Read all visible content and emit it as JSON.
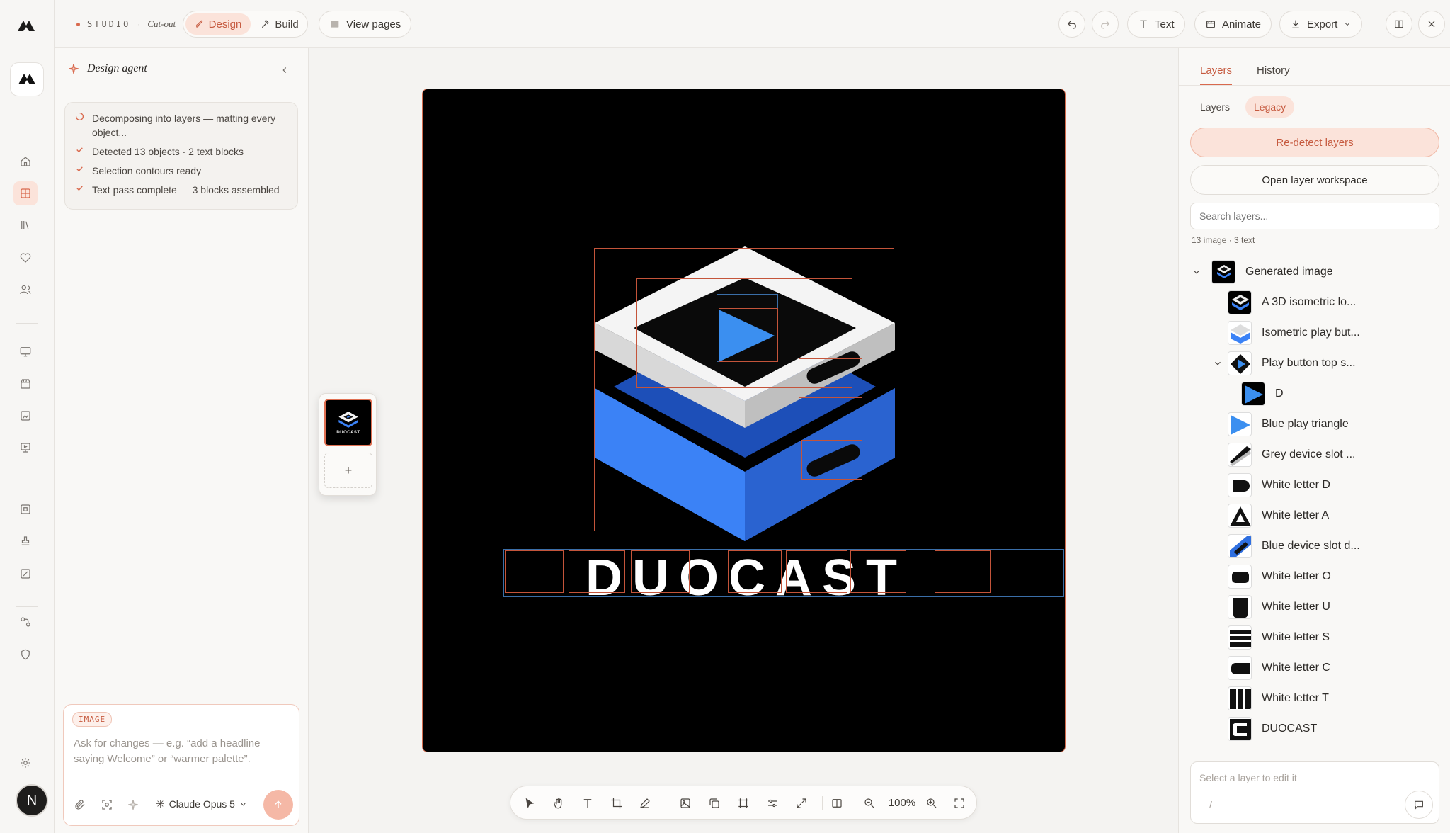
{
  "topbar": {
    "studio_label": "STUDIO",
    "separator": "·",
    "mode_label": "Cut-out",
    "design_tab": "Design",
    "build_tab": "Build",
    "view_pages": "View pages",
    "text_button": "Text",
    "animate_button": "Animate",
    "export_button": "Export"
  },
  "left_panel": {
    "title": "Design agent",
    "steps": [
      {
        "status": "running",
        "text": "Decomposing into layers — matting every object..."
      },
      {
        "status": "done",
        "text": "Detected 13 objects · 2 text blocks"
      },
      {
        "status": "done",
        "text": "Selection contours ready"
      },
      {
        "status": "done",
        "text": "Text pass complete — 3 blocks assembled"
      }
    ],
    "composer": {
      "tag": "IMAGE",
      "placeholder": "Ask for changes — e.g. “add a headline saying Welcome” or “warmer palette”.",
      "model": "Claude Opus 5"
    }
  },
  "canvas": {
    "logo_text": "DUOCAST",
    "thumb_label": "DUOCAST",
    "add_page": "+"
  },
  "toolbar": {
    "zoom": "100%"
  },
  "right_panel": {
    "tabs": [
      "Layers",
      "History"
    ],
    "subtabs": [
      "Layers",
      "Legacy"
    ],
    "redetect": "Re-detect layers",
    "open_workspace": "Open layer workspace",
    "search_placeholder": "Search layers...",
    "counts": "13 image · 3 text",
    "root_layer": "Generated image",
    "layers": [
      "A 3D isometric lo...",
      "Isometric play but...",
      "Play button top s...",
      "D",
      "Blue play triangle",
      "Grey device slot ...",
      "White letter D",
      "White letter A",
      "Blue device slot d...",
      "White letter O",
      "White letter U",
      "White letter S",
      "White letter C",
      "White letter T",
      "DUOCAST"
    ],
    "edit_placeholder": "Select a layer to edit it",
    "edit_slash": "/"
  },
  "user_initial": "N",
  "colors": {
    "accent": "#d9694d",
    "accent_bg": "#fbe3da",
    "logo_blue": "#3b82f6"
  }
}
